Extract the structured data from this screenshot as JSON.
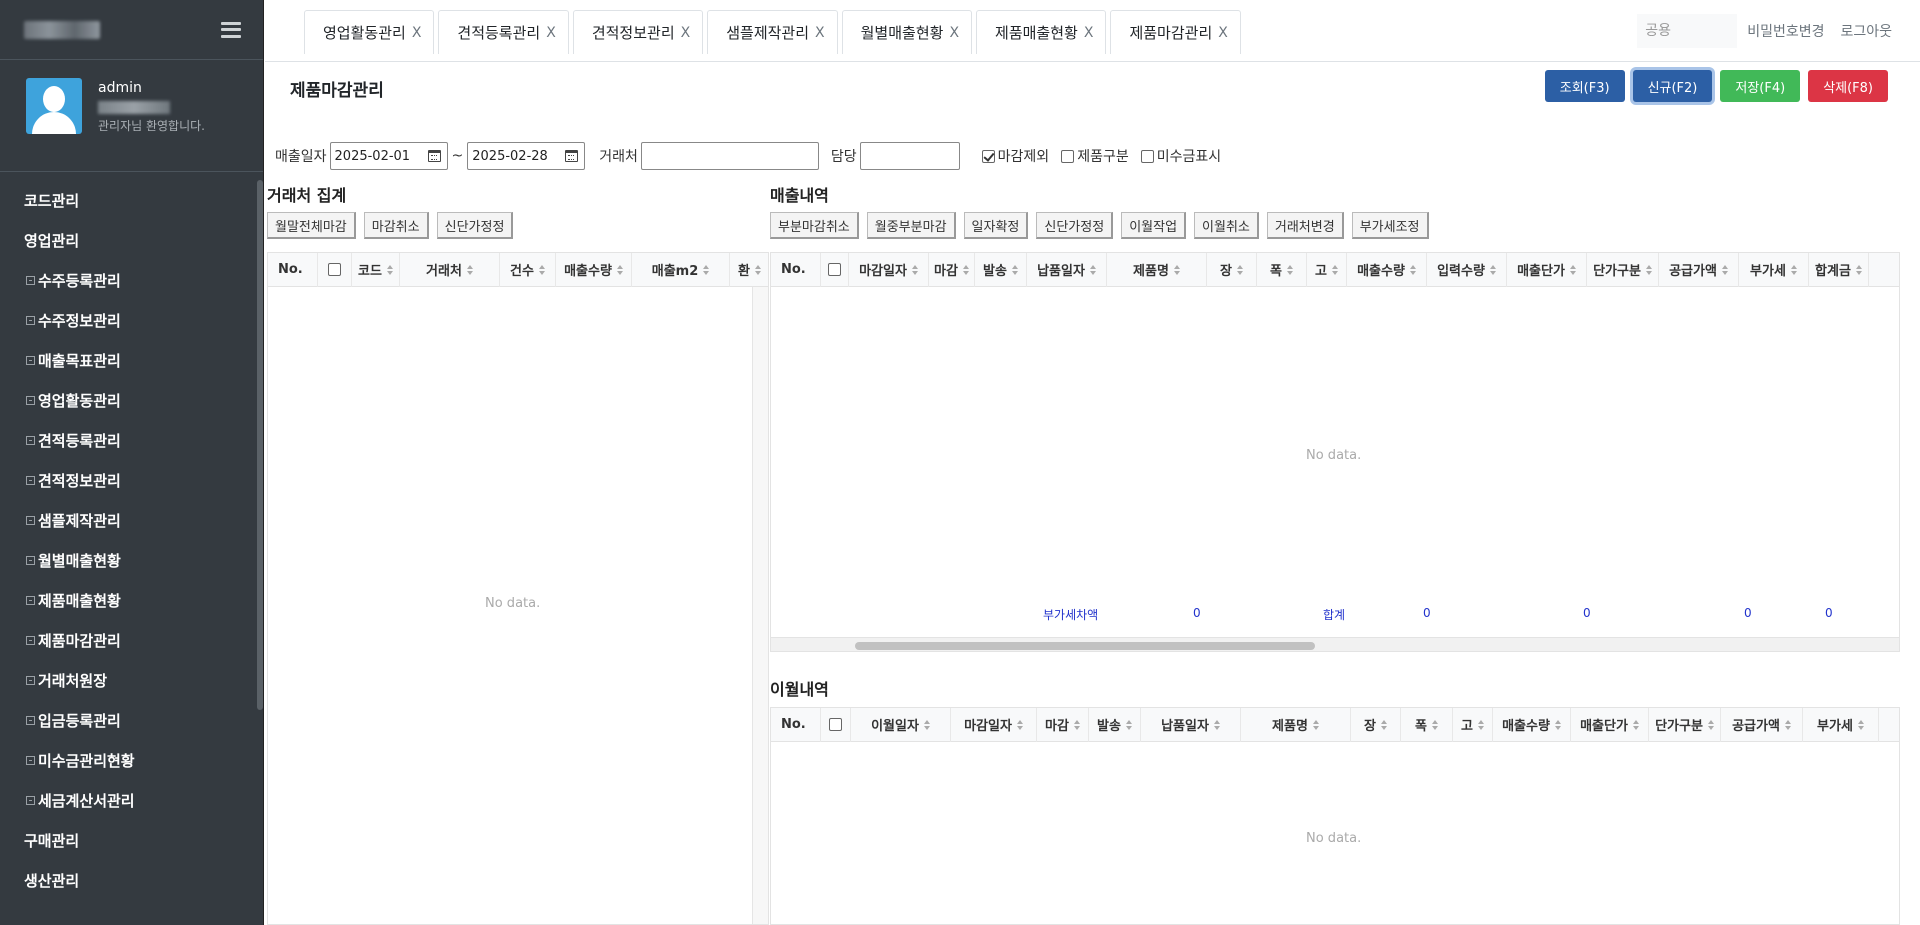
{
  "sidebar": {
    "user": {
      "name": "admin",
      "welcome": "관리자님 환영합니다."
    },
    "menu": [
      {
        "label": "코드관리",
        "sub": false
      },
      {
        "label": "영업관리",
        "sub": false
      },
      {
        "label": "수주등록관리",
        "sub": true
      },
      {
        "label": "수주정보관리",
        "sub": true
      },
      {
        "label": "매출목표관리",
        "sub": true
      },
      {
        "label": "영업활동관리",
        "sub": true
      },
      {
        "label": "견적등록관리",
        "sub": true
      },
      {
        "label": "견적정보관리",
        "sub": true
      },
      {
        "label": "샘플제작관리",
        "sub": true
      },
      {
        "label": "월별매출현황",
        "sub": true
      },
      {
        "label": "제품매출현황",
        "sub": true
      },
      {
        "label": "제품마감관리",
        "sub": true
      },
      {
        "label": "거래처원장",
        "sub": true
      },
      {
        "label": "입금등록관리",
        "sub": true
      },
      {
        "label": "미수금관리현황",
        "sub": true
      },
      {
        "label": "세금계산서관리",
        "sub": true
      },
      {
        "label": "구매관리",
        "sub": false
      },
      {
        "label": "생산관리",
        "sub": false
      }
    ]
  },
  "tabs": [
    {
      "label": "영업활동관리",
      "close": "X"
    },
    {
      "label": "견적등록관리",
      "close": "X"
    },
    {
      "label": "견적정보관리",
      "close": "X"
    },
    {
      "label": "샘플제작관리",
      "close": "X"
    },
    {
      "label": "월별매출현황",
      "close": "X"
    },
    {
      "label": "제품매출현황",
      "close": "X"
    },
    {
      "label": "제품마감관리",
      "close": "X"
    }
  ],
  "topRight": {
    "commonPlaceholder": "공용",
    "changePassword": "비밀번호변경",
    "logout": "로그아웃"
  },
  "page": {
    "title": "제품마감관리",
    "actions": {
      "search": "조회(F3)",
      "new": "신규(F2)",
      "save": "저장(F4)",
      "delete": "삭제(F8)"
    }
  },
  "filters": {
    "dateLabel": "매출일자",
    "dateFrom": "2025-02-01",
    "tilde": "~",
    "dateTo": "2025-02-28",
    "clientLabel": "거래처",
    "managerLabel": "담당",
    "checkboxes": [
      {
        "label": "마감제외",
        "checked": true
      },
      {
        "label": "제품구분",
        "checked": false
      },
      {
        "label": "미수금표시",
        "checked": false
      }
    ]
  },
  "clientSummary": {
    "title": "거래처 집계",
    "buttons": [
      "월말전체마감",
      "마감취소",
      "신단가정정"
    ],
    "columns": [
      "No.",
      "",
      "코드",
      "거래처",
      "건수",
      "매출수량",
      "매출m2",
      "환"
    ],
    "noData": "No data."
  },
  "sales": {
    "title": "매출내역",
    "buttons": [
      "부분마감취소",
      "월중부분마감",
      "일자확정",
      "신단가정정",
      "이월작업",
      "이월취소",
      "거래처변경",
      "부가세조정"
    ],
    "columns": [
      "No.",
      "",
      "마감일자",
      "마감",
      "발송",
      "납품일자",
      "제품명",
      "장",
      "폭",
      "고",
      "매출수량",
      "입력수량",
      "매출단가",
      "단가구분",
      "공급가액",
      "부가세",
      "합계금"
    ],
    "noData": "No data.",
    "summary": {
      "vatDiffLabel": "부가세차액",
      "vatDiffValue": "0",
      "totalLabel": "합계",
      "qty": "0",
      "unit": "0",
      "supply": "0",
      "vat": "0"
    }
  },
  "carryover": {
    "title": "이월내역",
    "columns": [
      "No.",
      "",
      "이월일자",
      "마감일자",
      "마감",
      "발송",
      "납품일자",
      "제품명",
      "장",
      "폭",
      "고",
      "매출수량",
      "매출단가",
      "단가구분",
      "공급가액",
      "부가세"
    ],
    "noData": "No data."
  }
}
